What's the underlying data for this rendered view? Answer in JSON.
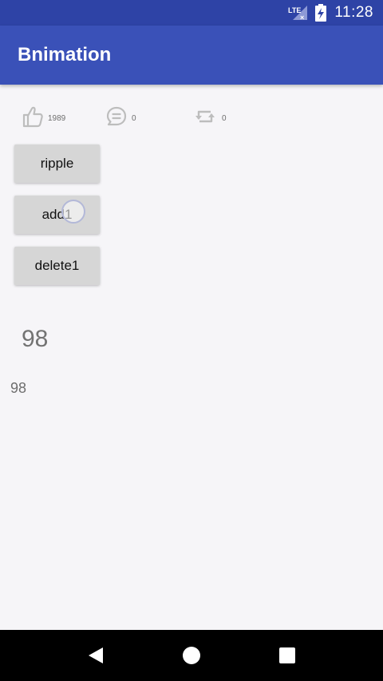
{
  "status_bar": {
    "network": "LTE",
    "time": "11:28",
    "icons": [
      "lte-signal-icon",
      "battery-charging-icon"
    ]
  },
  "app_bar": {
    "title": "Bnimation"
  },
  "actions": {
    "like": {
      "icon": "thumbs-up-icon",
      "count": "1989"
    },
    "comment": {
      "icon": "comment-icon",
      "count": "0"
    },
    "repost": {
      "icon": "repost-icon",
      "count": "0"
    }
  },
  "buttons": {
    "ripple": "ripple",
    "add": "add1",
    "delete": "delete1"
  },
  "counters": {
    "large": "98",
    "small": "98"
  },
  "nav_bar": {
    "icons": [
      "back-icon",
      "home-icon",
      "recents-icon"
    ]
  },
  "colors": {
    "status_bar": "#2e43a6",
    "app_bar": "#3a51b8",
    "background": "#f6f5f8",
    "button": "#d6d6d6",
    "icon_gray": "#bdbdbd"
  }
}
